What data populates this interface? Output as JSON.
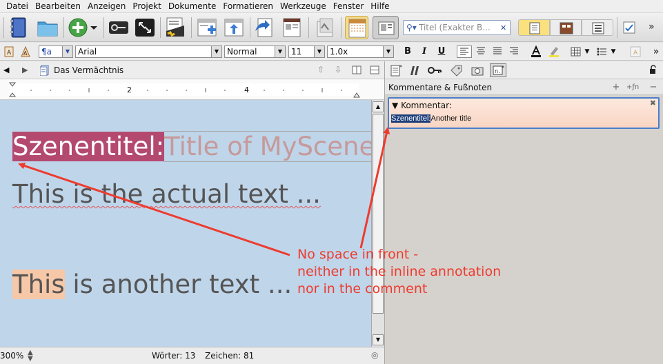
{
  "menu": [
    "Datei",
    "Bearbeiten",
    "Anzeigen",
    "Projekt",
    "Dokumente",
    "Formatieren",
    "Werkzeuge",
    "Fenster",
    "Hilfe"
  ],
  "search": {
    "placeholder": "Titel (Exakter B..."
  },
  "toolbar_more": "»",
  "format": {
    "style": "¶a",
    "font": "Arial",
    "weight": "Normal",
    "size": "11",
    "spacing": "1.0x",
    "bold": "B",
    "italic": "I",
    "underline": "U"
  },
  "editor": {
    "doc_title": "Das Vermächtnis",
    "ruler_labels": [
      "2",
      "4"
    ],
    "line1_label": "Szenentitel:",
    "line1_note": "Title of MyScene",
    "line2": "This is the actual text ...",
    "line3_highlight": "This",
    "line3_rest": " is another text ..."
  },
  "status": {
    "zoom": "300%",
    "words": "Wörter: 13",
    "chars": "Zeichen: 81"
  },
  "inspector": {
    "header": "Kommentare & Fußnoten",
    "comment_label": "Kommentar:",
    "comment_selected": "Szenentitel:",
    "comment_rest": "Another title"
  },
  "annotation": {
    "line1": "No space in front -",
    "line2": "neither in the inline annotation",
    "line3": "nor in the comment"
  },
  "colors": {
    "annotation_red": "#ee3b2e",
    "editor_bg": "#bfd5ea",
    "label_highlight": "#b4496f",
    "comment_bg": "#fde9de"
  }
}
